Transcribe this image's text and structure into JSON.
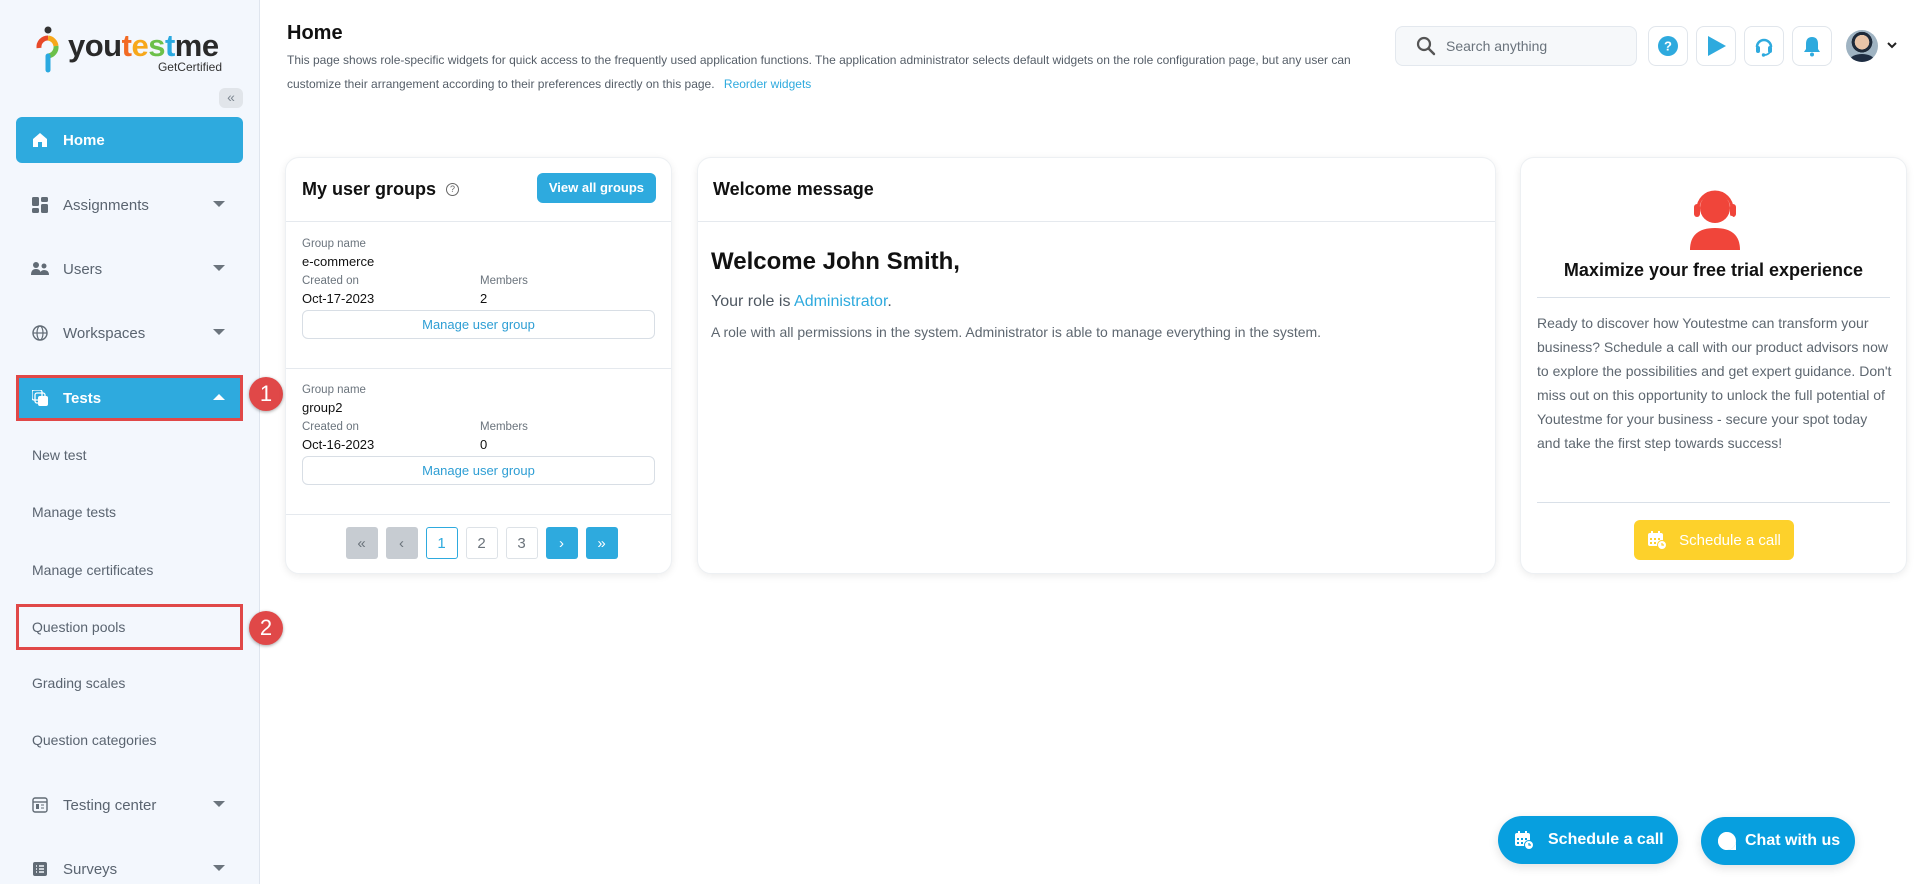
{
  "brand": {
    "name_parts": [
      "you",
      "t",
      "e",
      "s",
      "t",
      "me"
    ],
    "tagline": "GetCertified",
    "colors": {
      "primary": "#2eaade",
      "accent_yellow": "#fdd12b",
      "highlight_red": "#e04848",
      "trial_icon": "#f0453a"
    }
  },
  "sidebar": {
    "collapse_icon": "double-chevron-left",
    "items": [
      {
        "label": "Home",
        "icon": "home-icon",
        "active": true
      },
      {
        "label": "Assignments",
        "icon": "dashboard-icon",
        "expandable": true
      },
      {
        "label": "Users",
        "icon": "users-icon",
        "expandable": true
      },
      {
        "label": "Workspaces",
        "icon": "globe-icon",
        "expandable": true
      },
      {
        "label": "Tests",
        "icon": "tests-icon",
        "expanded": true,
        "highlighted": true,
        "marker": "1"
      },
      {
        "label": "Testing center",
        "icon": "testing-center-icon",
        "expandable": true
      },
      {
        "label": "Surveys",
        "icon": "surveys-icon",
        "expandable": true
      }
    ],
    "sub_items": [
      {
        "label": "New test"
      },
      {
        "label": "Manage tests"
      },
      {
        "label": "Manage certificates"
      },
      {
        "label": "Question pools",
        "highlighted": true,
        "marker": "2"
      },
      {
        "label": "Grading scales"
      },
      {
        "label": "Question categories"
      }
    ]
  },
  "header": {
    "title": "Home",
    "description": "This page shows role-specific widgets for quick access to the frequently used application functions. The application administrator selects default widgets on the role configuration page, but any user can customize their arrangement according to their preferences directly on this page.",
    "reorder_link": "Reorder widgets",
    "search_placeholder": "Search anything",
    "buttons": [
      "help-icon",
      "play-icon",
      "headset-icon",
      "bell-icon"
    ]
  },
  "groups_widget": {
    "title": "My user groups",
    "view_all": "View all groups",
    "label_group_name": "Group name",
    "label_created_on": "Created on",
    "label_members": "Members",
    "manage_label": "Manage user group",
    "groups": [
      {
        "name": "e-commerce",
        "created_on": "Oct-17-2023",
        "members": "2"
      },
      {
        "name": "group2",
        "created_on": "Oct-16-2023",
        "members": "0"
      }
    ],
    "pagination": {
      "pages": [
        "1",
        "2",
        "3"
      ],
      "current": "1"
    }
  },
  "welcome_widget": {
    "title": "Welcome message",
    "greeting": "Welcome John Smith,",
    "role_prefix": "Your role is ",
    "role": "Administrator",
    "role_suffix": ".",
    "role_description": "A role with all permissions in the system. Administrator is able to manage everything in the system."
  },
  "trial_widget": {
    "title": "Maximize your free trial experience",
    "text": "Ready to discover how Youtestme can transform your business? Schedule a call with our product advisors now to explore the possibilities and get expert guidance. Don't miss out on this opportunity to unlock the full potential of Youtestme for your business - secure your spot today and take the first step towards success!",
    "button": "Schedule a call"
  },
  "floating": {
    "schedule": "Schedule a call",
    "chat": "Chat with us"
  }
}
